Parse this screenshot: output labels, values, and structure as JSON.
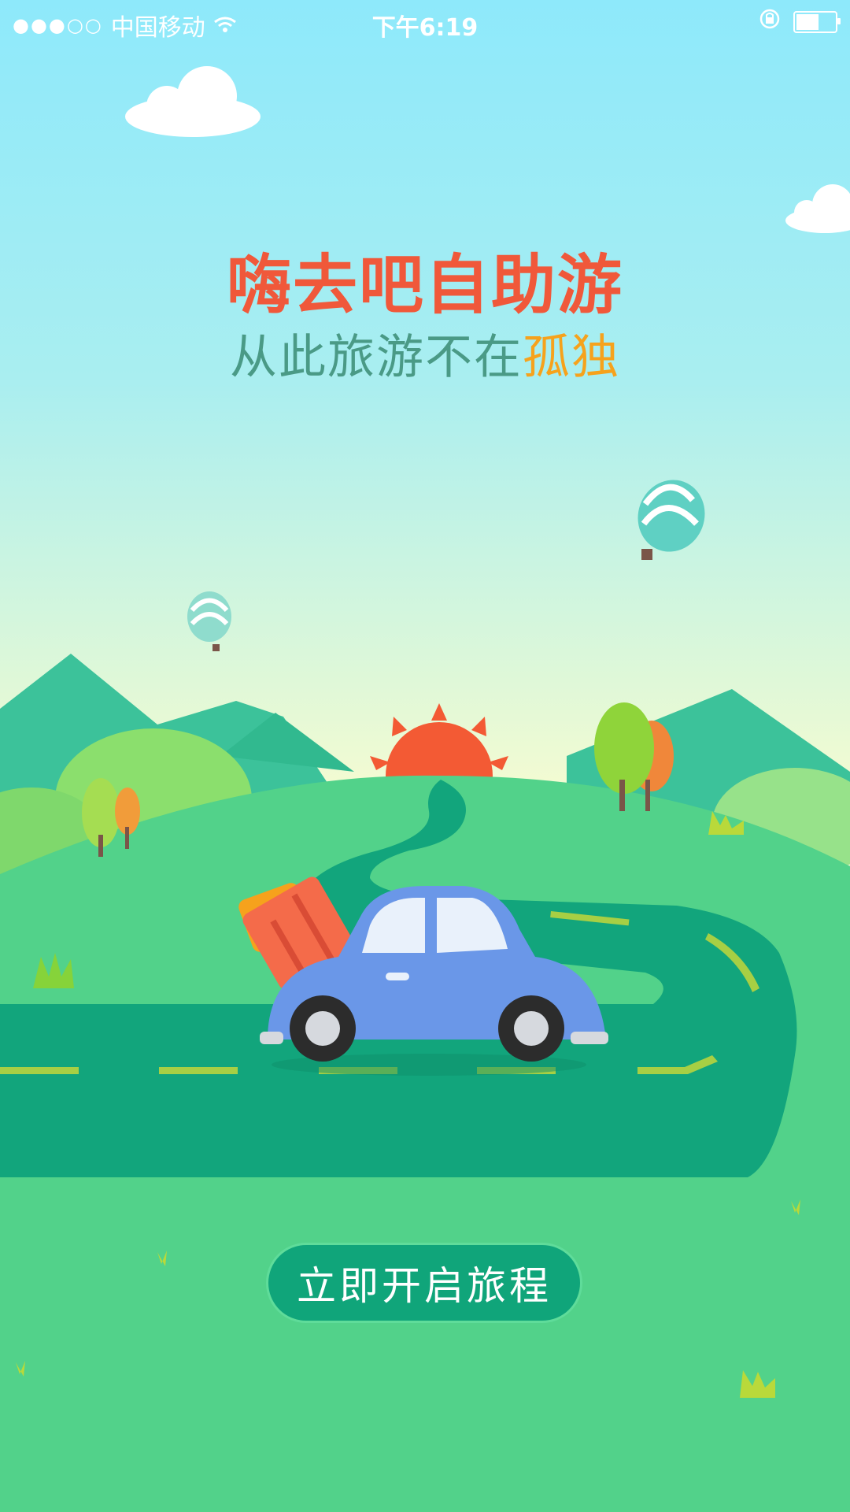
{
  "statusbar": {
    "signal": "●●●○○",
    "carrier": "中国移动",
    "time": "下午6:19",
    "icons": [
      "wifi-icon",
      "rotation-lock-icon",
      "battery-icon"
    ]
  },
  "hero": {
    "title": "嗨去吧自助游",
    "subtitle_main": "从此旅游不在",
    "subtitle_highlight": "孤独"
  },
  "cta": {
    "label": "立即开启旅程"
  },
  "colors": {
    "title": "#f0583a",
    "subtitle": "#4a9a86",
    "highlight": "#f6a21c",
    "button": "#10a57a"
  }
}
